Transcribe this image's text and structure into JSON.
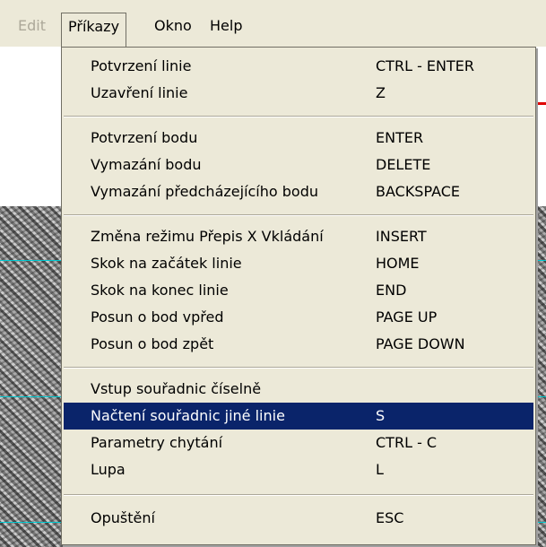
{
  "menubar": {
    "items": [
      {
        "label": "Edit",
        "state": "disabled"
      },
      {
        "label": "Příkazy",
        "state": "open"
      },
      {
        "label": "Okno",
        "state": "normal"
      },
      {
        "label": "Help",
        "state": "normal"
      }
    ]
  },
  "menu": {
    "groups": [
      [
        {
          "label": "Potvrzení linie",
          "shortcut": "CTRL - ENTER"
        },
        {
          "label": "Uzavření linie",
          "shortcut": "Z"
        }
      ],
      [
        {
          "label": "Potvrzení bodu",
          "shortcut": "ENTER"
        },
        {
          "label": "Vymazání bodu",
          "shortcut": "DELETE"
        },
        {
          "label": "Vymazání předcházejícího bodu",
          "shortcut": "BACKSPACE"
        }
      ],
      [
        {
          "label": "Změna režimu Přepis X Vkládání",
          "shortcut": "INSERT"
        },
        {
          "label": "Skok na začátek linie",
          "shortcut": "HOME"
        },
        {
          "label": "Skok na konec linie",
          "shortcut": "END"
        },
        {
          "label": "Posun o bod vpřed",
          "shortcut": "PAGE UP"
        },
        {
          "label": "Posun o bod zpět",
          "shortcut": "PAGE DOWN"
        }
      ],
      [
        {
          "label": "Vstup souřadnic číselně",
          "shortcut": ""
        },
        {
          "label": "Načtení souřadnic jiné linie",
          "shortcut": "S",
          "highlighted": true
        },
        {
          "label": "Parametry chytání",
          "shortcut": "CTRL - C"
        },
        {
          "label": "Lupa",
          "shortcut": "L"
        }
      ],
      [
        {
          "label": "Opuštění",
          "shortcut": "ESC"
        }
      ]
    ]
  },
  "colors": {
    "menu_bg": "#ece9d8",
    "highlight_bg": "#0a246a",
    "highlight_fg": "#ffffff",
    "disabled_fg": "#aca899",
    "cyan_line": "#00c8d0",
    "red_mark": "#e00000"
  }
}
